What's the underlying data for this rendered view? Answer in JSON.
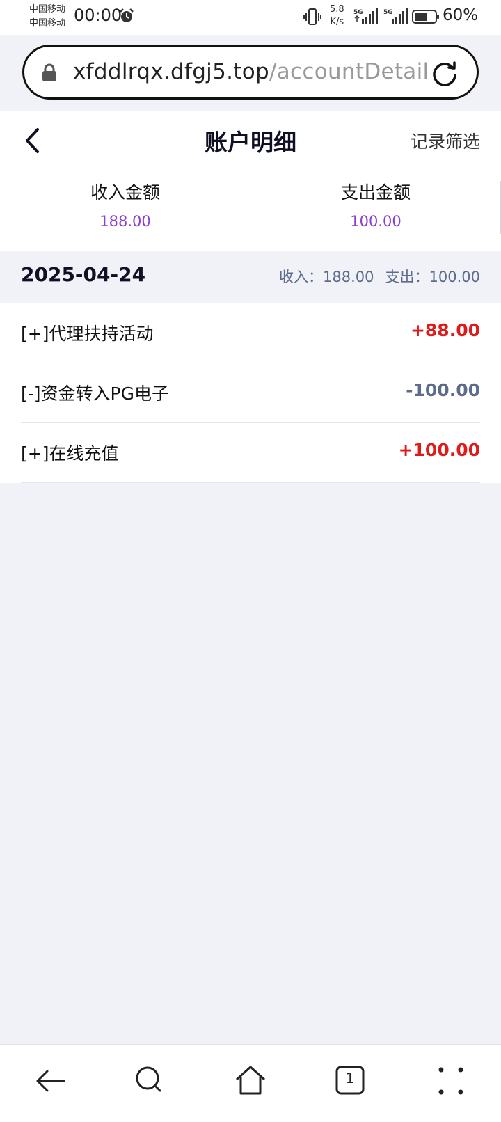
{
  "status_bar": {
    "carrier_1": "中国移动",
    "carrier_2": "中国移动",
    "time": "00:00",
    "net_speed_value": "5.8",
    "net_speed_unit": "K/s",
    "signal_1_label": "5G",
    "signal_2_label": "5G",
    "battery": "60%",
    "icons": [
      "alarm-icon",
      "vibrate-icon",
      "signal-icon",
      "battery-icon"
    ]
  },
  "browser": {
    "url_domain": "xfddlrqx.dfgj5.top",
    "url_path": "/accountDetail"
  },
  "header": {
    "title": "账户明细",
    "filter_label": "记录筛选"
  },
  "summary": {
    "income_label": "收入金额",
    "income_value": "188.00",
    "expense_label": "支出金额",
    "expense_value": "100.00"
  },
  "groups": [
    {
      "date": "2025-04-24",
      "income_text": "收入：188.00",
      "expense_text": "支出：100.00",
      "transactions": [
        {
          "label": "[+]代理扶持活动",
          "amount": "+88.00"
        },
        {
          "label": "[-]资金转入PG电子",
          "amount": "-100.00"
        },
        {
          "label": "[+]在线充值",
          "amount": "+100.00"
        }
      ]
    }
  ],
  "bottom_nav": {
    "tab_count": "1",
    "icons": [
      "back-arrow-icon",
      "search-icon",
      "home-icon",
      "tabs-icon",
      "menu-dots-icon"
    ]
  },
  "colors": {
    "accent_purple": "#8b3fce",
    "positive_red": "#de1b1b",
    "negative_gray": "#5d6b8c",
    "page_bg": "#f0f2f8"
  }
}
